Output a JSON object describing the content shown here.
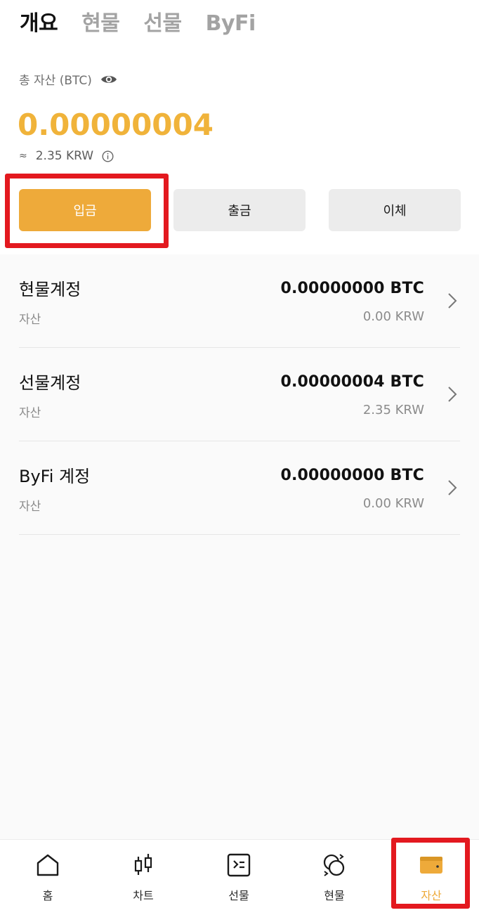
{
  "tabs": [
    {
      "label": "개요",
      "active": true
    },
    {
      "label": "현물",
      "active": false
    },
    {
      "label": "선물",
      "active": false
    },
    {
      "label": "ByFi",
      "active": false
    }
  ],
  "summary": {
    "total_label": "총 자산 (BTC)",
    "total_value": "0.00000004",
    "approx_sign": "≈",
    "approx_value": "2.35 KRW"
  },
  "actions": {
    "deposit": "입금",
    "withdraw": "출금",
    "transfer": "이체"
  },
  "accounts": [
    {
      "name": "현물계정",
      "sub": "자산",
      "btc": "0.00000000 BTC",
      "krw": "0.00 KRW"
    },
    {
      "name": "선물계정",
      "sub": "자산",
      "btc": "0.00000004 BTC",
      "krw": "2.35 KRW"
    },
    {
      "name": "ByFi 계정",
      "sub": "자산",
      "btc": "0.00000000 BTC",
      "krw": "0.00 KRW"
    }
  ],
  "bottom_nav": [
    {
      "label": "홈",
      "icon": "home-icon",
      "active": false
    },
    {
      "label": "차트",
      "icon": "candlestick-icon",
      "active": false
    },
    {
      "label": "선물",
      "icon": "futures-icon",
      "active": false
    },
    {
      "label": "현물",
      "icon": "spot-icon",
      "active": false
    },
    {
      "label": "자산",
      "icon": "wallet-icon",
      "active": true
    }
  ],
  "colors": {
    "accent": "#eeaa3a",
    "total_value": "#f0b33a",
    "highlight": "#e3191f"
  }
}
